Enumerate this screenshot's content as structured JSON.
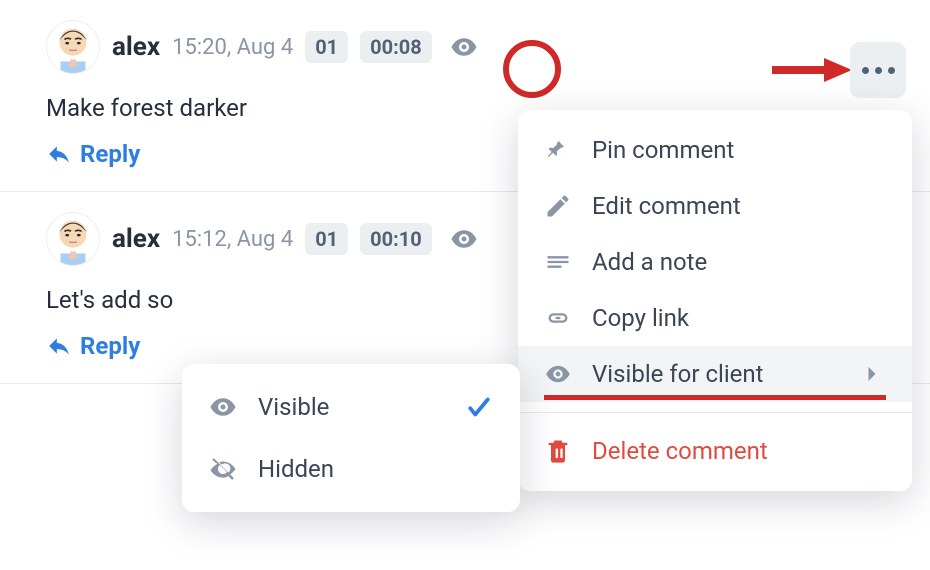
{
  "comments": [
    {
      "author": "alex",
      "timestamp": "15:20, Aug 4",
      "frame_badge": "01",
      "timecode": "00:08",
      "body": "Make forest darker",
      "reply_label": "Reply"
    },
    {
      "author": "alex",
      "timestamp": "15:12, Aug 4",
      "frame_badge": "01",
      "timecode": "00:10",
      "body": "Let's add so",
      "reply_label": "Reply"
    }
  ],
  "menu": {
    "pin": "Pin comment",
    "edit": "Edit comment",
    "note": "Add a note",
    "copy": "Copy link",
    "visibility": "Visible for client",
    "delete": "Delete comment"
  },
  "submenu": {
    "visible": "Visible",
    "hidden": "Hidden"
  },
  "colors": {
    "accent_blue": "#2f7de1",
    "annotation_red": "#cf2a27",
    "danger": "#e04b3f"
  }
}
